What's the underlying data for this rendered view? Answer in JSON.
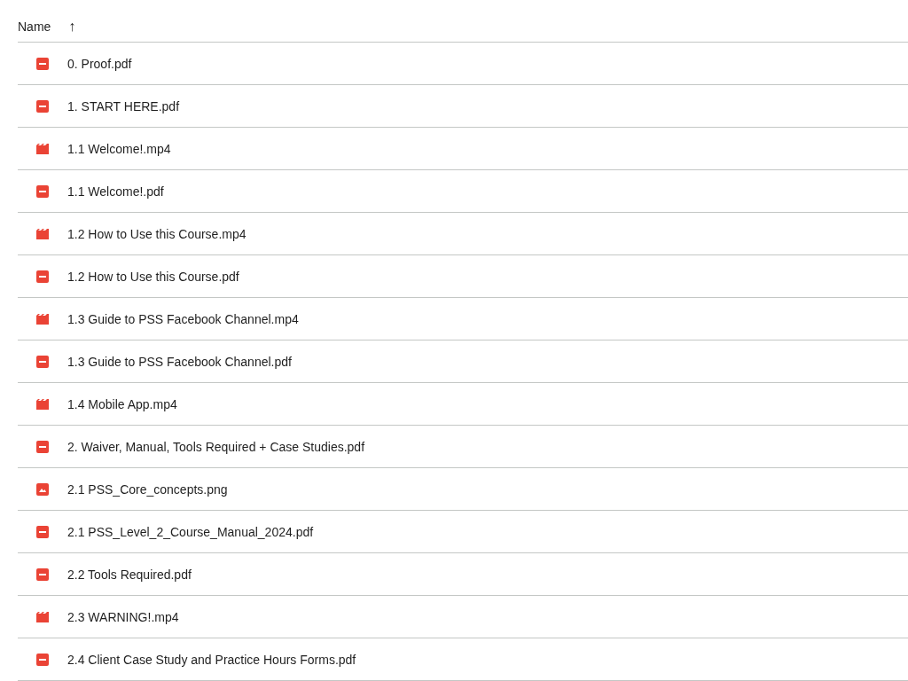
{
  "table": {
    "columns": [
      {
        "label": "Name",
        "sort_indicator": "↑"
      }
    ],
    "rows": [
      {
        "kind": "pdf",
        "name": "0. Proof.pdf"
      },
      {
        "kind": "pdf",
        "name": "1. START HERE.pdf"
      },
      {
        "kind": "video",
        "name": "1.1 Welcome!.mp4"
      },
      {
        "kind": "pdf",
        "name": "1.1 Welcome!.pdf"
      },
      {
        "kind": "video",
        "name": "1.2 How to Use this Course.mp4"
      },
      {
        "kind": "pdf",
        "name": "1.2 How to Use this Course.pdf"
      },
      {
        "kind": "video",
        "name": "1.3 Guide to PSS Facebook Channel.mp4"
      },
      {
        "kind": "pdf",
        "name": "1.3 Guide to PSS Facebook Channel.pdf"
      },
      {
        "kind": "video",
        "name": "1.4 Mobile App.mp4"
      },
      {
        "kind": "pdf",
        "name": "2. Waiver, Manual, Tools Required + Case Studies.pdf"
      },
      {
        "kind": "image",
        "name": "2.1 PSS_Core_concepts.png"
      },
      {
        "kind": "pdf",
        "name": "2.1 PSS_Level_2_Course_Manual_2024.pdf"
      },
      {
        "kind": "pdf",
        "name": "2.2 Tools Required.pdf"
      },
      {
        "kind": "video",
        "name": "2.3 WARNING!.mp4"
      },
      {
        "kind": "pdf",
        "name": "2.4 Client Case Study and Practice Hours Forms.pdf"
      }
    ]
  }
}
